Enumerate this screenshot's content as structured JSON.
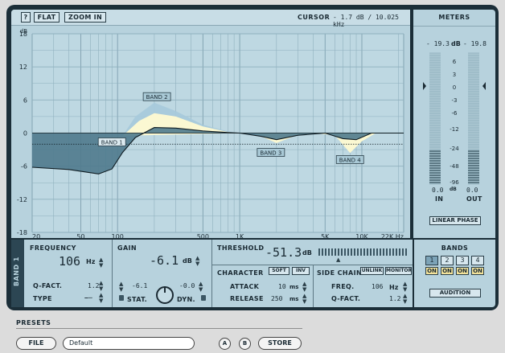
{
  "toolbar": {
    "help_label": "?",
    "flat_label": "FLAT",
    "zoom_label": "ZOOM IN",
    "cursor_label": "CURSOR",
    "cursor_value": "- 1.7 dB / 10.025 kHz"
  },
  "graph": {
    "db_unit": "dB",
    "y_ticks": [
      "18",
      "12",
      "6",
      "0",
      "-6",
      "-12",
      "-18"
    ],
    "x_ticks": [
      "20",
      "50",
      "100",
      "500",
      "1K",
      "5K",
      "10K",
      "22K Hz"
    ],
    "band_labels": [
      "BAND 1",
      "BAND 2",
      "BAND 3",
      "BAND 4"
    ],
    "colors": {
      "bg": "#b7d2dd",
      "fill_dark": "#4f7a8d",
      "fill_light": "#fbf8d2",
      "fill_band2": "#a6cadb",
      "grid": "#8fb0be"
    }
  },
  "chart_data": {
    "type": "area",
    "xlabel": "",
    "ylabel": "dB",
    "xscale": "log",
    "xlim": [
      20,
      22000
    ],
    "ylim": [
      -18,
      18
    ],
    "x_ticks": [
      20,
      50,
      100,
      500,
      1000,
      5000,
      10000,
      22000
    ],
    "y_ticks": [
      18,
      12,
      6,
      0,
      -6,
      -12,
      -18
    ],
    "series": [
      {
        "name": "",
        "x": [
          20,
          40,
          70,
          90,
          110,
          140,
          200,
          300,
          500,
          800,
          1000,
          1500,
          2000,
          3000,
          5000,
          7000,
          9000,
          12000,
          15000,
          22000
        ],
        "y": [
          -6.2,
          -6.6,
          -7.4,
          -6.5,
          -3.5,
          -0.8,
          1.0,
          0.9,
          0.4,
          0.1,
          0,
          -0.6,
          -1.2,
          -0.4,
          0,
          -1.0,
          -1.2,
          0,
          0,
          0
        ]
      }
    ],
    "threshold_db": -2
  },
  "meters": {
    "title": "METERS",
    "in_peak": "- 19.3",
    "out_peak": "- 19.8",
    "db_unit": "dB",
    "scale": [
      "6",
      "3",
      "0",
      "-3",
      "-6",
      "-12",
      "-24",
      "-48",
      "-96"
    ],
    "in_bottom": "0.0",
    "out_bottom": "0.0",
    "in_label": "IN",
    "out_label": "OUT",
    "linear_phase_label": "LINEAR PHASE"
  },
  "band_panel": {
    "tab_label": "BAND 1",
    "frequency": {
      "title": "FREQUENCY",
      "value": "106",
      "unit": "Hz"
    },
    "qfact": {
      "label": "Q-FACT.",
      "value": "1.2"
    },
    "type": {
      "label": "TYPE",
      "value": "−─"
    },
    "gain": {
      "title": "GAIN",
      "value": "-6.1",
      "unit": "dB",
      "stat_value": "-6.1",
      "dyn_value": "-0.0",
      "stat_label": "STAT.",
      "dyn_label": "DYN."
    },
    "threshold": {
      "title": "THRESHOLD",
      "value": "-51.3",
      "unit": "dB"
    },
    "character": {
      "title": "CHARACTER",
      "soft_label": "SOFT",
      "inv_label": "INV",
      "attack_label": "ATTACK",
      "attack_value": "10",
      "attack_unit": "ms",
      "release_label": "RELEASE",
      "release_value": "250",
      "release_unit": "ms"
    },
    "sidechain": {
      "title": "SIDE CHAIN",
      "unlink_label": "UNLINK",
      "monitor_label": "MONITOR",
      "freq_label": "FREQ.",
      "freq_value": "106",
      "freq_unit": "Hz",
      "qfact_label": "Q-FACT.",
      "qfact_value": "1.2"
    },
    "bands": {
      "title": "BANDS",
      "numbers": [
        "1",
        "2",
        "3",
        "4"
      ],
      "on_labels": [
        "ON",
        "ON",
        "ON",
        "ON"
      ],
      "audition_label": "AUDITION"
    }
  },
  "presets": {
    "title": "PRESETS",
    "file_label": "FILE",
    "current": "Default",
    "a_label": "A",
    "b_label": "B",
    "store_label": "STORE"
  }
}
